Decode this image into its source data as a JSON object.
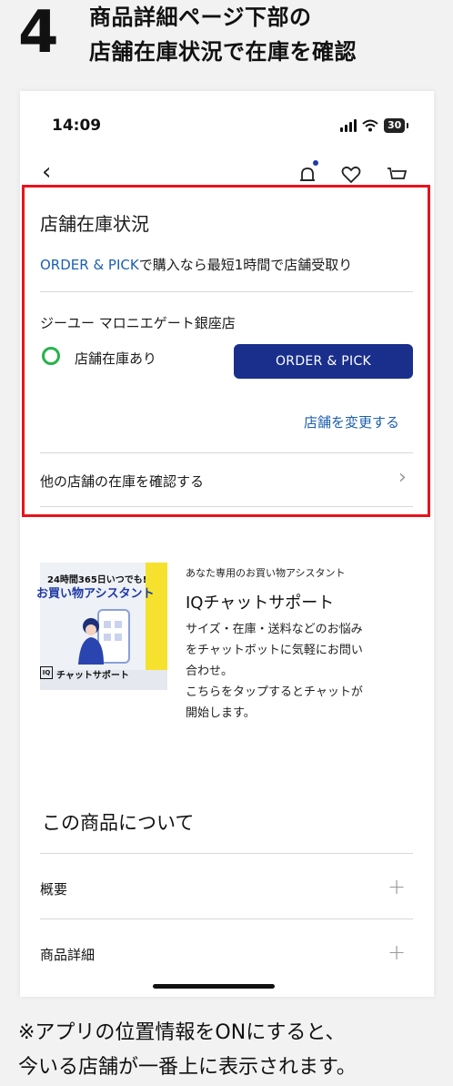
{
  "header": {
    "step_number": "4",
    "title_line1": "商品詳細ページ下部の",
    "title_line2": "店舗在庫状況で在庫を確認"
  },
  "status_bar": {
    "time": "14:09",
    "battery": "30"
  },
  "nav": {
    "back_icon": "chevron-left-icon",
    "icons": [
      "bell-icon",
      "heart-icon",
      "cart-icon"
    ]
  },
  "store_stock": {
    "title": "店舗在庫状況",
    "order_pick_link": "ORDER & PICK",
    "order_pick_text": "で購入なら最短1時間で店舗受取り",
    "store_name": "ジーユー マロニエゲート銀座店",
    "stock_status": "店舗在庫あり",
    "order_button": "ORDER & PICK",
    "change_store": "店舗を変更する",
    "other_stores": "他の店舗の在庫を確認する",
    "stock_color": "#27b24a",
    "highlight_color": "#e8121b"
  },
  "chat_promo": {
    "image_subtitle": "24時間365日いつでも!",
    "image_heading": "お買い物アシスタント",
    "image_footer": "チャットサポート",
    "small_label": "あなた専用のお買い物アシスタント",
    "title": "IQチャットサポート",
    "description_lines": [
      "サイズ・在庫・送料などのお悩み",
      "をチャットボットに気軽にお問い",
      "合わせ。",
      "こちらをタップするとチャットが",
      "開始します。"
    ]
  },
  "about": {
    "title": "この商品について",
    "items": [
      {
        "label": "概要"
      },
      {
        "label": "商品詳細"
      }
    ]
  },
  "footnote": {
    "line1": "※アプリの位置情報をONにすると、",
    "line2": "今いる店舗が一番上に表示されます。"
  }
}
